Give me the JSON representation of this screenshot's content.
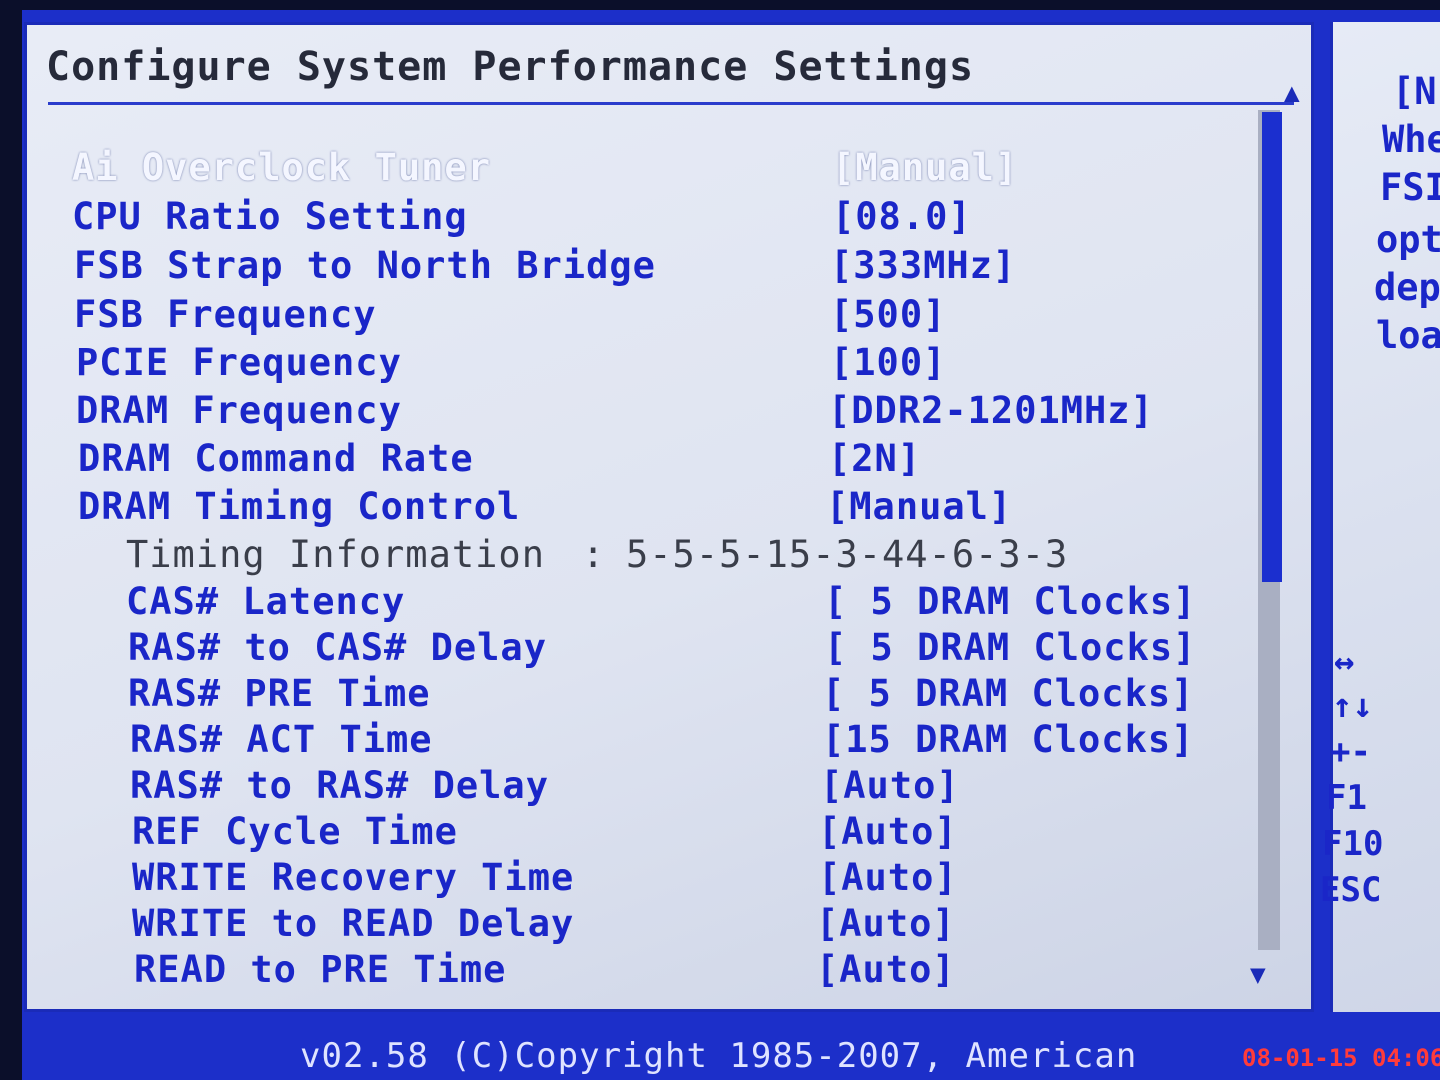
{
  "title": "Configure System Performance Settings",
  "settings": [
    {
      "label": "Ai Overclock Tuner",
      "value": "[Manual]"
    },
    {
      "label": "CPU Ratio Setting",
      "value": "[08.0]"
    },
    {
      "label": "FSB Strap to North Bridge",
      "value": "[333MHz]"
    },
    {
      "label": "FSB Frequency",
      "value": "[500]"
    },
    {
      "label": "PCIE Frequency",
      "value": "[100]"
    },
    {
      "label": "DRAM Frequency",
      "value": "[DDR2-1201MHz]"
    },
    {
      "label": "DRAM Command Rate",
      "value": "[2N]"
    },
    {
      "label": "DRAM Timing Control",
      "value": "[Manual]"
    }
  ],
  "timing_info": {
    "label": "Timing Information",
    "separator": ":",
    "value": "5-5-5-15-3-44-6-3-3"
  },
  "timings": [
    {
      "label": "CAS# Latency",
      "value": "[ 5 DRAM Clocks]"
    },
    {
      "label": "RAS# to CAS# Delay",
      "value": "[ 5 DRAM Clocks]"
    },
    {
      "label": "RAS# PRE Time",
      "value": "[ 5 DRAM Clocks]"
    },
    {
      "label": "RAS# ACT Time",
      "value": "[15 DRAM Clocks]"
    },
    {
      "label": "RAS# to RAS# Delay",
      "value": "[Auto]"
    },
    {
      "label": "REF Cycle Time",
      "value": "[Auto]"
    },
    {
      "label": "WRITE Recovery Time",
      "value": "[Auto]"
    },
    {
      "label": "WRITE to READ Delay",
      "value": "[Auto]"
    },
    {
      "label": "READ to PRE Time",
      "value": "[Auto]"
    }
  ],
  "help_panel": {
    "lines": [
      "[N",
      "Whe",
      "FSI",
      "opt",
      "dep",
      "loa"
    ]
  },
  "keys": [
    "↔",
    "↑↓",
    "+-",
    "F1",
    "F10",
    "ESC"
  ],
  "scroll": {
    "up_arrow": "▲",
    "down_arrow": "▼"
  },
  "footer": {
    "copyright": "v02.58 (C)Copyright 1985-2007, American"
  },
  "camera_stamp": "08-01-15 04:06",
  "colors": {
    "item_blue": "#1a26c8",
    "frame_blue": "#1c2fc9",
    "selected_white": "#f4f6ff"
  }
}
